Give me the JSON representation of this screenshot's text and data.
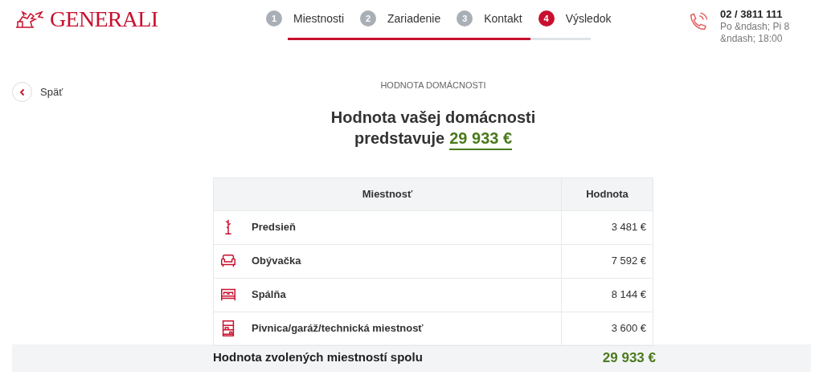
{
  "logo": {
    "text": "GENERALI"
  },
  "steps": [
    {
      "number": "1",
      "label": "Miestnosti",
      "selected": false
    },
    {
      "number": "2",
      "label": "Zariadenie",
      "selected": false
    },
    {
      "number": "3",
      "label": "Kontakt",
      "selected": false
    },
    {
      "number": "4",
      "label": "Výsledok",
      "selected": true
    }
  ],
  "progress": {
    "level": 0.8
  },
  "contact": {
    "phone": "02 / 3811 111",
    "hours": "Po &ndash; Pi 8 &ndash; 18:00"
  },
  "back": {
    "label": "Späť"
  },
  "section_label": "HODNOTA DOMÁCNOSTI",
  "heading": {
    "line_1": "Hodnota vašej domácnosti",
    "line_2_prefix": "predstavuje",
    "amount": "29 933 €"
  },
  "table": {
    "columns": [
      "Miestnosť",
      "Hodnota"
    ],
    "rows": [
      {
        "kind": "hallway",
        "room": "Predsieň",
        "value": "3 481 €"
      },
      {
        "kind": "living",
        "room": "Obývačka",
        "value": "7 592 €"
      },
      {
        "kind": "bedroom",
        "room": "Spálňa",
        "value": "8 144 €"
      },
      {
        "kind": "storage",
        "room": "Pivnica/garáž/technická miestnosť",
        "value": "3 600 €"
      }
    ]
  },
  "total": {
    "label": "Hodnota zvolených miestností spolu",
    "amount": "29 933 €"
  }
}
